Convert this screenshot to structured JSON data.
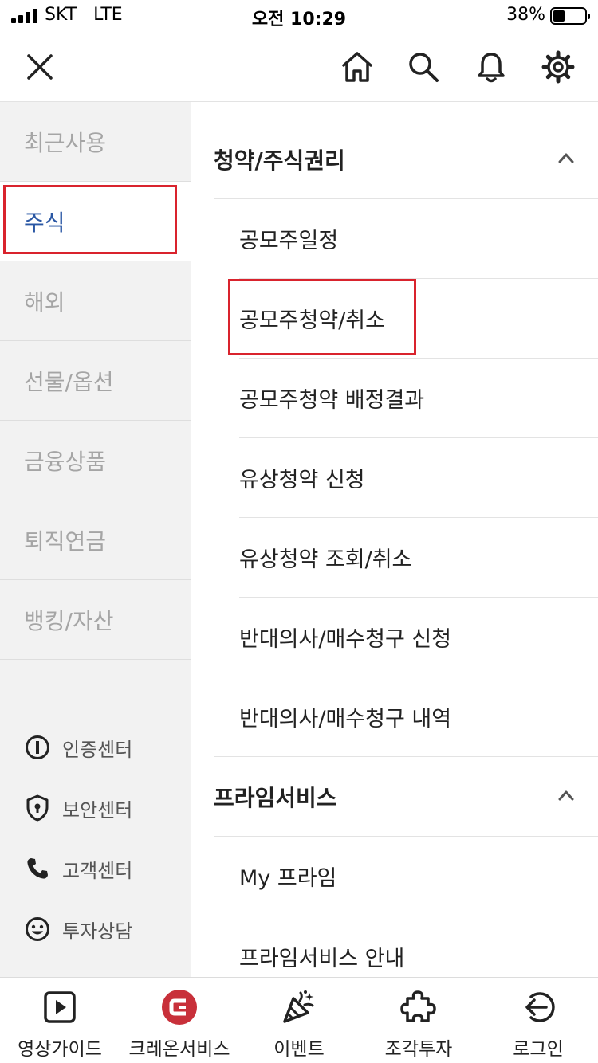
{
  "status_bar": {
    "carrier": "SKT   LTE",
    "time": "오전 10:29",
    "battery": "38%"
  },
  "header": {
    "icons": [
      "close-icon",
      "home-icon",
      "search-icon",
      "bell-icon",
      "gear-icon"
    ]
  },
  "sidebar": {
    "items": [
      {
        "label": "최근사용"
      },
      {
        "label": "주식"
      },
      {
        "label": "해외"
      },
      {
        "label": "선물/옵션"
      },
      {
        "label": "금융상품"
      },
      {
        "label": "퇴직연금"
      },
      {
        "label": "뱅킹/자산"
      }
    ],
    "utilities": [
      {
        "label": "인증센터",
        "icon": "certificate-icon"
      },
      {
        "label": "보안센터",
        "icon": "shield-icon"
      },
      {
        "label": "고객센터",
        "icon": "phone-icon"
      },
      {
        "label": "투자상담",
        "icon": "smiley-icon"
      }
    ]
  },
  "menu": {
    "sections": [
      {
        "title": "청약/주식권리",
        "items": [
          "공모주일정",
          "공모주청약/취소",
          "공모주청약 배정결과",
          "유상청약 신청",
          "유상청약 조회/취소",
          "반대의사/매수청구 신청",
          "반대의사/매수청구 내역"
        ]
      },
      {
        "title": "프라임서비스",
        "items": [
          "My 프라임",
          "프라임서비스 안내"
        ]
      }
    ]
  },
  "tabbar": {
    "tabs": [
      {
        "label": "영상가이드",
        "icon": "play-icon"
      },
      {
        "label": "크레온서비스",
        "icon": "creon-logo-icon"
      },
      {
        "label": "이벤트",
        "icon": "party-popper-icon"
      },
      {
        "label": "조각투자",
        "icon": "puzzle-icon"
      },
      {
        "label": "로그인",
        "icon": "login-icon"
      }
    ]
  },
  "colors": {
    "accent_blue": "#2a57a4",
    "highlight_red": "#d9232d",
    "sidebar_bg": "#f2f2f2",
    "creon_red": "#c8303a"
  }
}
